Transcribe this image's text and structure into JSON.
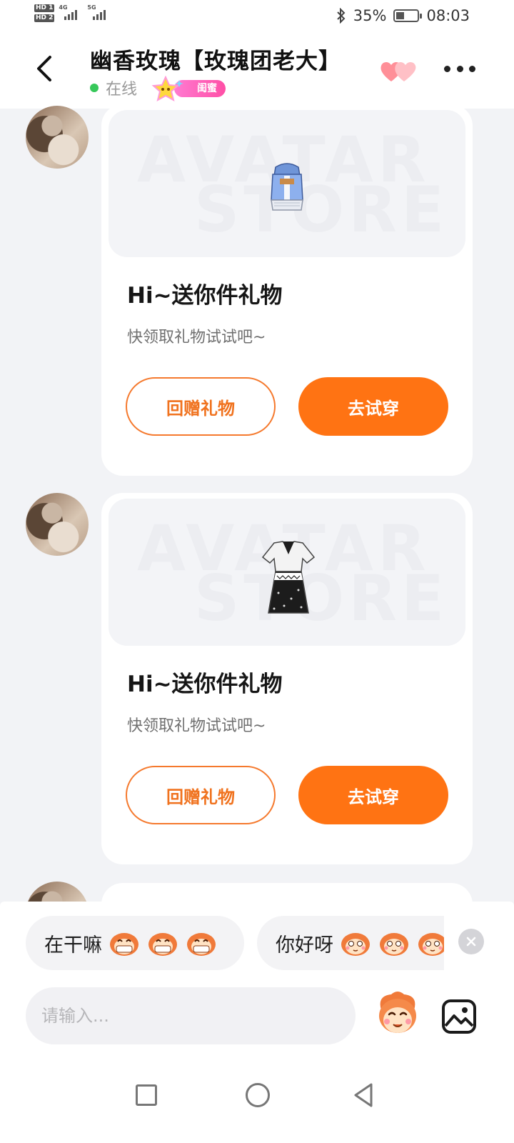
{
  "status_bar": {
    "hd1": "HD 1",
    "hd2": "HD 2",
    "net1": "4G",
    "net2": "5G",
    "battery": "35%",
    "time": "08:03"
  },
  "header": {
    "title": "幽香玫瑰【玫瑰团老大】",
    "online_status": "在线",
    "relation_badge": "闺蜜"
  },
  "messages": [
    {
      "watermark_1": "AVATAR",
      "watermark_2": "STORE",
      "item_icon": "blue-hooded-jacket",
      "title": "Hi~送你件礼物",
      "subtitle": "快领取礼物试试吧~",
      "return_gift_label": "回赠礼物",
      "try_on_label": "去试穿"
    },
    {
      "watermark_1": "AVATAR",
      "watermark_2": "STORE",
      "item_icon": "black-white-dress",
      "title": "Hi~送你件礼物",
      "subtitle": "快领取礼物试试吧~",
      "return_gift_label": "回赠礼物",
      "try_on_label": "去试穿"
    }
  ],
  "quick_replies": [
    {
      "text": "在干嘛",
      "emoji": "grinning-monkey-emoji"
    },
    {
      "text": "你好呀",
      "emoji": "blushing-monkey-emoji"
    }
  ],
  "input": {
    "placeholder": "请输入..."
  },
  "colors": {
    "accent": "#ff7313",
    "online": "#37c85a",
    "badge": "#ff4fa6"
  }
}
